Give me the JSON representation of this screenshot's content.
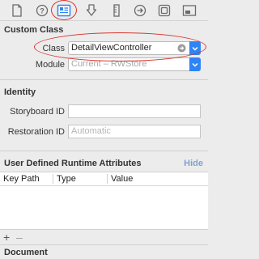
{
  "toolbar": {
    "icons": [
      "file-icon",
      "help-icon",
      "identity-inspector-icon",
      "attributes-icon",
      "size-inspector-icon",
      "connections-icon",
      "bindings-icon",
      "effects-icon"
    ],
    "active": "identity-inspector-icon",
    "accent": "#2f84f5"
  },
  "custom_class": {
    "header": "Custom Class",
    "class_label": "Class",
    "class_value": "DetailViewController",
    "module_label": "Module",
    "module_placeholder": "Current – RWStore"
  },
  "identity": {
    "header": "Identity",
    "storyboard_id_label": "Storyboard ID",
    "storyboard_id_value": "",
    "restoration_id_label": "Restoration ID",
    "restoration_id_placeholder": "Automatic"
  },
  "runtime_attributes": {
    "header": "User Defined Runtime Attributes",
    "hide_label": "Hide",
    "columns": [
      "Key Path",
      "Type",
      "Value"
    ],
    "rows": [],
    "add_label": "+",
    "remove_label": "–"
  },
  "document": {
    "header": "Document"
  },
  "annotation_color": "#d9342b"
}
